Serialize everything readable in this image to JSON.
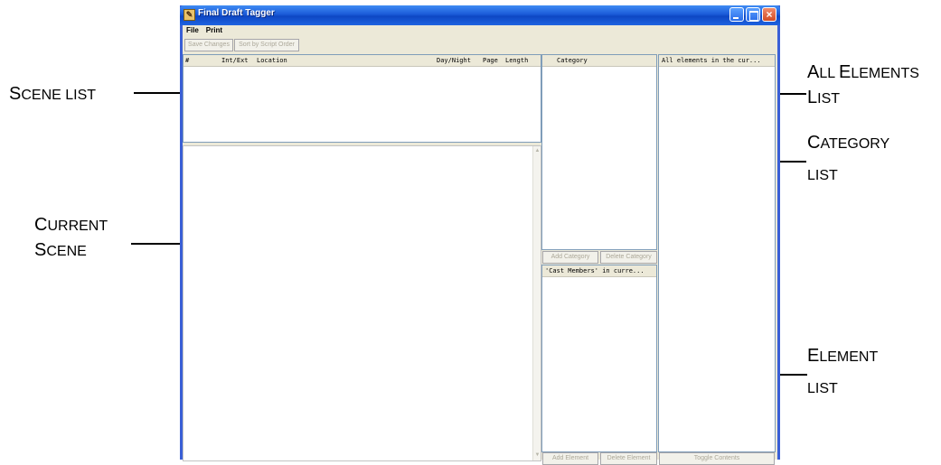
{
  "window": {
    "title": "Final Draft Tagger",
    "app_icon": "tagger-app-icon"
  },
  "menu": [
    "File",
    "Print"
  ],
  "toolbar": {
    "save_changes": "Save Changes",
    "sort_by_script_order": "Sort by Script Order"
  },
  "scene_list": {
    "columns": [
      "#",
      "Int/Ext",
      "Location",
      "Day/Night",
      "Page",
      "Length"
    ]
  },
  "category_panel": {
    "header": "Category",
    "add_button": "Add Category",
    "delete_button": "Delete Category"
  },
  "element_panel": {
    "header": "'Cast Members' in curre...",
    "add_button": "Add Element",
    "delete_button": "Delete Element"
  },
  "all_elements_panel": {
    "header": "All elements in the cur...",
    "toggle_button": "Toggle Contents"
  },
  "callouts": {
    "scene_list": {
      "cap": "S",
      "rest": "CENE LIST"
    },
    "current_scene": {
      "line1_cap": "C",
      "line1_rest": "URRENT",
      "line2_cap": "S",
      "line2_rest": "CENE"
    },
    "all_elements": {
      "line1_cap_a": "A",
      "line1_rest_a": "LL ",
      "line1_cap_b": "E",
      "line1_rest_b": "LEMENTS",
      "line2_cap": "L",
      "line2_rest": "IST"
    },
    "category": {
      "line1_cap": "C",
      "line1_rest": "ATEGORY",
      "line2": "LIST"
    },
    "element": {
      "line1_cap": "E",
      "line1_rest": "LEMENT",
      "line2": "LIST"
    }
  },
  "colors": {
    "titlebar": "#1a5ad8",
    "window_face": "#ece9d8",
    "close_button": "#d24c24"
  }
}
